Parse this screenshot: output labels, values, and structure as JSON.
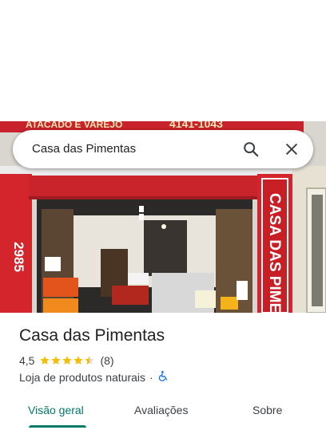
{
  "search": {
    "query": "Casa das Pimentas",
    "search_icon": "search-icon",
    "close_icon": "close-icon"
  },
  "photo": {
    "sign_top_left": "ATACADO E VAREJO",
    "sign_top_right": "4141-1043",
    "sign_side": "CASA DAS PIMENTAS",
    "sign_number": "2985"
  },
  "place": {
    "title": "Casa das Pimentas",
    "rating": "4,5",
    "stars_value": 4.5,
    "review_count": "(8)",
    "category": "Loja de produtos naturais",
    "separator": "·",
    "accessibility_icon": "wheelchair-icon"
  },
  "tabs": [
    {
      "label": "Visão geral",
      "active": true
    },
    {
      "label": "Avaliações",
      "active": false
    },
    {
      "label": "Sobre",
      "active": false
    }
  ],
  "colors": {
    "accent": "#00796b",
    "star": "#fbbc04",
    "accessibility": "#1a73e8"
  }
}
